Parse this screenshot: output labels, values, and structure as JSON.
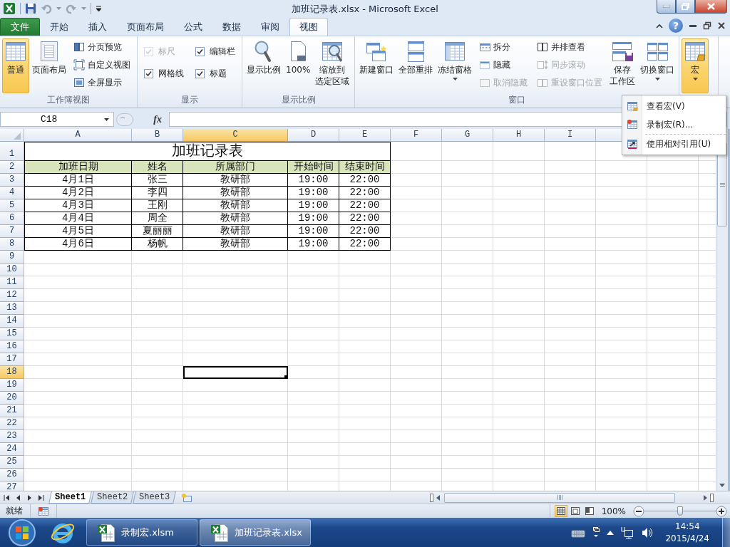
{
  "window": {
    "title": "加班记录表.xlsx - Microsoft Excel",
    "help": "?"
  },
  "ribbon_tabs": [
    {
      "label": "文件",
      "kind": "file",
      "selected": false
    },
    {
      "label": "开始",
      "kind": "tab",
      "selected": false
    },
    {
      "label": "插入",
      "kind": "tab",
      "selected": false
    },
    {
      "label": "页面布局",
      "kind": "tab",
      "selected": false
    },
    {
      "label": "公式",
      "kind": "tab",
      "selected": false
    },
    {
      "label": "数据",
      "kind": "tab",
      "selected": false
    },
    {
      "label": "审阅",
      "kind": "tab",
      "selected": false
    },
    {
      "label": "视图",
      "kind": "tab",
      "selected": true
    }
  ],
  "ribbon_groups": [
    {
      "label": "工作簿视图",
      "items": [
        {
          "kind": "large",
          "label": "普通",
          "selected": true,
          "disabled": false,
          "dropdown": false
        },
        {
          "kind": "large",
          "label": "页面布局",
          "selected": false,
          "disabled": false,
          "dropdown": false
        },
        {
          "kind": "small",
          "label": "分页预览",
          "disabled": false
        },
        {
          "kind": "small",
          "label": "自定义视图",
          "disabled": false
        },
        {
          "kind": "small",
          "label": "全屏显示",
          "disabled": false
        }
      ]
    },
    {
      "label": "显示",
      "items": [
        {
          "kind": "check",
          "label": "标尺",
          "checked": true,
          "disabled": true
        },
        {
          "kind": "check",
          "label": "编辑栏",
          "checked": true,
          "disabled": false
        },
        {
          "kind": "check",
          "label": "网格线",
          "checked": true,
          "disabled": false
        },
        {
          "kind": "check",
          "label": "标题",
          "checked": true,
          "disabled": false
        }
      ]
    },
    {
      "label": "显示比例",
      "items": [
        {
          "kind": "large",
          "label": "显示比例",
          "selected": false,
          "disabled": false,
          "dropdown": false
        },
        {
          "kind": "large",
          "label": "100%",
          "selected": false,
          "disabled": false,
          "dropdown": false
        },
        {
          "kind": "large",
          "label": [
            "缩放到",
            "选定区域"
          ],
          "selected": false,
          "disabled": false,
          "dropdown": false
        }
      ]
    },
    {
      "label": "窗口",
      "items": [
        {
          "kind": "large",
          "label": "新建窗口",
          "selected": false,
          "disabled": false,
          "dropdown": false
        },
        {
          "kind": "large",
          "label": "全部重排",
          "selected": false,
          "disabled": false,
          "dropdown": false
        },
        {
          "kind": "large",
          "label": "冻结窗格",
          "selected": false,
          "disabled": false,
          "dropdown": true
        },
        {
          "kind": "small",
          "label": "拆分",
          "disabled": false
        },
        {
          "kind": "small",
          "label": "隐藏",
          "disabled": false
        },
        {
          "kind": "small",
          "label": "取消隐藏",
          "disabled": true
        },
        {
          "kind": "small",
          "label": "并排查看",
          "disabled": false
        },
        {
          "kind": "small",
          "label": "同步滚动",
          "disabled": true
        },
        {
          "kind": "small",
          "label": "重设窗口位置",
          "disabled": true
        },
        {
          "kind": "large",
          "label": [
            "保存",
            "工作区"
          ],
          "selected": false,
          "disabled": false,
          "dropdown": false
        },
        {
          "kind": "large",
          "label": "切换窗口",
          "selected": false,
          "disabled": false,
          "dropdown": true
        }
      ]
    },
    {
      "items": [
        {
          "kind": "large",
          "label": "宏",
          "selected": true,
          "disabled": false,
          "dropdown": true
        }
      ]
    }
  ],
  "macro_menu": {
    "items": [
      {
        "label": "查看宏(V)",
        "separator_before": false
      },
      {
        "label": "录制宏(R)...",
        "separator_before": false
      },
      {
        "label": "使用相对引用(U)",
        "separator_before": true
      }
    ]
  },
  "formula_bar": {
    "name_box": "C18",
    "function_label": "fx"
  },
  "sheet": {
    "columns": [
      {
        "label": "A",
        "selected": false
      },
      {
        "label": "B",
        "selected": false
      },
      {
        "label": "C",
        "selected": true
      },
      {
        "label": "D",
        "selected": false
      },
      {
        "label": "E",
        "selected": false
      },
      {
        "label": "F",
        "selected": false
      },
      {
        "label": "G",
        "selected": false
      },
      {
        "label": "H",
        "selected": false
      },
      {
        "label": "I",
        "selected": false
      }
    ],
    "rows": [
      {
        "label": "1",
        "selected": false
      },
      {
        "label": "2",
        "selected": false
      },
      {
        "label": "3",
        "selected": false
      },
      {
        "label": "4",
        "selected": false
      },
      {
        "label": "5",
        "selected": false
      },
      {
        "label": "6",
        "selected": false
      },
      {
        "label": "7",
        "selected": false
      },
      {
        "label": "8",
        "selected": false
      },
      {
        "label": "9",
        "selected": false
      },
      {
        "label": "10",
        "selected": false
      },
      {
        "label": "11",
        "selected": false
      },
      {
        "label": "12",
        "selected": false
      },
      {
        "label": "13",
        "selected": false
      },
      {
        "label": "14",
        "selected": false
      },
      {
        "label": "15",
        "selected": false
      },
      {
        "label": "16",
        "selected": false
      },
      {
        "label": "17",
        "selected": false
      },
      {
        "label": "18",
        "selected": true
      },
      {
        "label": "19",
        "selected": false
      },
      {
        "label": "20",
        "selected": false
      },
      {
        "label": "21",
        "selected": false
      },
      {
        "label": "22",
        "selected": false
      },
      {
        "label": "23",
        "selected": false
      },
      {
        "label": "24",
        "selected": false
      },
      {
        "label": "25",
        "selected": false
      },
      {
        "label": "26",
        "selected": false
      },
      {
        "label": "27",
        "selected": false
      }
    ],
    "title": "加班记录表",
    "header": [
      "加班日期",
      "姓名",
      "所属部门",
      "开始时间",
      "结束时间"
    ],
    "data": [
      [
        "4月1日",
        "张三",
        "教研部",
        "19:00",
        "22:00"
      ],
      [
        "4月2日",
        "李四",
        "教研部",
        "19:00",
        "22:00"
      ],
      [
        "4月3日",
        "王刚",
        "教研部",
        "19:00",
        "22:00"
      ],
      [
        "4月4日",
        "周全",
        "教研部",
        "19:00",
        "22:00"
      ],
      [
        "4月5日",
        "夏丽丽",
        "教研部",
        "19:00",
        "22:00"
      ],
      [
        "4月6日",
        "杨帆",
        "教研部",
        "19:00",
        "22:00"
      ]
    ]
  },
  "sheet_tabs": [
    {
      "label": "Sheet1",
      "selected": true
    },
    {
      "label": "Sheet2",
      "selected": false
    },
    {
      "label": "Sheet3",
      "selected": false
    }
  ],
  "status_bar": {
    "text": "就绪",
    "view_buttons": [
      {
        "selected": true
      },
      {
        "selected": false
      },
      {
        "selected": false
      }
    ],
    "zoom": "100%",
    "zoom_slider": {
      "level": 0.5
    }
  },
  "taskbar": {
    "items": [
      {
        "label": "录制宏.xlsm",
        "selected": false
      },
      {
        "label": "加班记录表.xlsx",
        "selected": true
      }
    ],
    "time": "14:54",
    "date": "2015/4/24"
  }
}
